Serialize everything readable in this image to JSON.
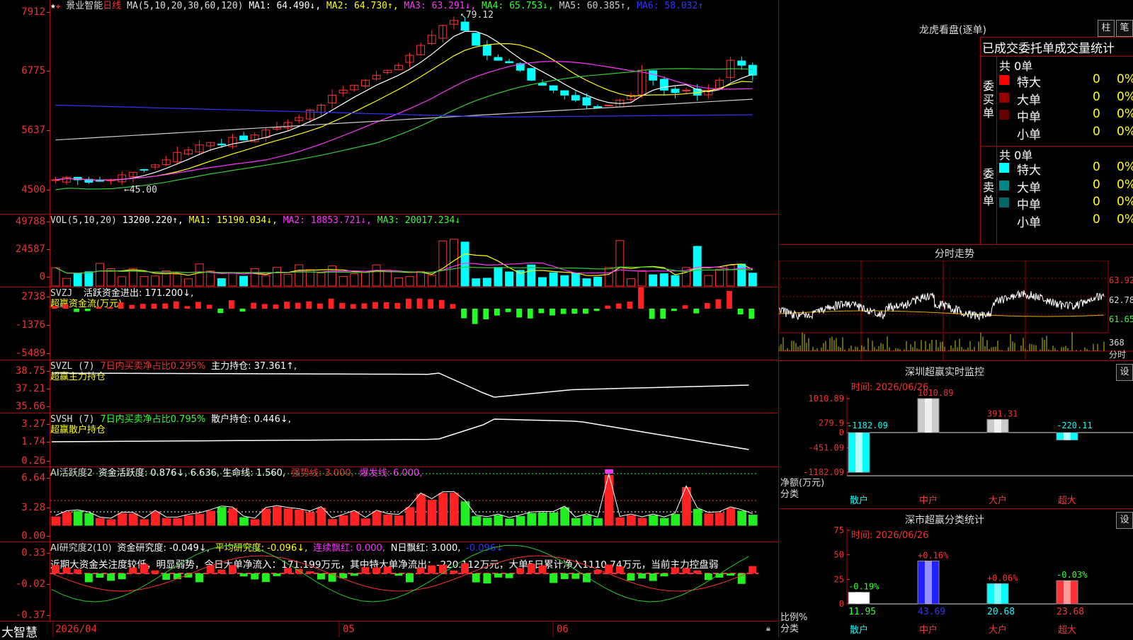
{
  "title_bar": {
    "app_name": "景业智能",
    "period": "日线"
  },
  "price_pane": {
    "ma_label": "MA(5,10,20,30,60,120)",
    "ma_values": [
      {
        "name": "MA1:",
        "value": "64.490↓,",
        "color": "#ffffff"
      },
      {
        "name": "MA2:",
        "value": "64.730↑,",
        "color": "#ffff00"
      },
      {
        "name": "MA3:",
        "value": "63.291↓,",
        "color": "#ff33ff"
      },
      {
        "name": "MA4:",
        "value": "65.753↓,",
        "color": "#33ff33"
      },
      {
        "name": "MA5:",
        "value": "60.385↑,",
        "color": "#cccccc"
      },
      {
        "name": "MA6:",
        "value": "58.032↑",
        "color": "#3333ff"
      }
    ],
    "y_ticks": [
      "7912",
      "6775",
      "5637",
      "4500"
    ],
    "high_marker": "79.12",
    "low_marker": "45.00"
  },
  "vol_pane": {
    "label": "VOL(5,10,20)",
    "value": "13200.220↑,",
    "ma1": "MA1: 15190.034↓,",
    "ma2": "MA2: 18853.721↓,",
    "ma3": "MA3: 20017.234↓",
    "y_ticks": [
      "49788",
      "24587",
      "0"
    ]
  },
  "svzj_pane": {
    "label": "SVZJ",
    "desc": "活跃资金进出: 171.200↓,",
    "sub": "超赢资金流(万元)",
    "y_ticks": [
      "2738",
      "-1376",
      "-5489"
    ]
  },
  "svzl_pane": {
    "label": "SVZL (7)",
    "desc": "7日内买卖净占比0.295%",
    "desc2": "主力持仓: 37.361↑,",
    "sub": "超赢主力持仓",
    "y_ticks": [
      "38.75",
      "37.21",
      "35.66"
    ]
  },
  "svsh_pane": {
    "label": "SVSH (7)",
    "desc": "7日内买卖净占比0.795%",
    "desc2": "散户持仓: 0.446↓,",
    "sub": "超赢散户持仓",
    "y_ticks": [
      "3.27",
      "1.74",
      "0.26"
    ]
  },
  "ai_active_pane": {
    "label": "AI活跃度2",
    "desc": "资金活跃度: 0.876↓, 6.636, 生命线: 1.560,",
    "strong": "强势线: 3.000,",
    "burst": "爆发线: 6.000,",
    "y_ticks": [
      "6.64",
      "3.28",
      "0.00"
    ]
  },
  "ai_research_pane": {
    "label": "AI研究度2(10)",
    "desc": "资金研究度: -0.049↓,",
    "avg": "平均研究度: -0.096↓,",
    "cont": "连续飘红: 0.000,",
    "nday": "N日飘红: 3.000,",
    "last": "-0.096↓",
    "comment": "近期大资金关注度较低，明显弱势，今日大单净流入：171.199万元，其中特大单净流出：-220.112万元，大单5日累计净入1110.74万元，当前主力控盘弱",
    "y_ticks": [
      "0.33",
      "-0.02",
      "-0.37"
    ]
  },
  "bottom_bar": {
    "brand": "大智慧",
    "date_start": "2026/04",
    "may": "05",
    "jun": "06"
  },
  "dragon_tiger": {
    "title": "龙虎看盘(逐单)",
    "btn_bar": "柱",
    "btn_stroke": "笔",
    "stats_header": "已成交委托单成交量统计",
    "buy_label": "委买单",
    "sell_label": "委卖单",
    "buy_total": "共 0单",
    "sell_total": "共 0单",
    "buy_rows": [
      {
        "label": "特大",
        "count": "0",
        "pct": "0%",
        "color": "#ff0000"
      },
      {
        "label": "大单",
        "count": "0",
        "pct": "0%",
        "color": "#990000"
      },
      {
        "label": "中单",
        "count": "0",
        "pct": "0%",
        "color": "#660000"
      },
      {
        "label": "小单",
        "count": "0",
        "pct": "0%",
        "color": ""
      }
    ],
    "sell_rows": [
      {
        "label": "特大",
        "count": "0",
        "pct": "0%",
        "color": "#00ffff"
      },
      {
        "label": "大单",
        "count": "0",
        "pct": "0%",
        "color": "#008888"
      },
      {
        "label": "中单",
        "count": "0",
        "pct": "0%",
        "color": "#006666"
      },
      {
        "label": "小单",
        "count": "0",
        "pct": "0%",
        "color": ""
      }
    ]
  },
  "intraday": {
    "title": "分时走势",
    "right_ticks": [
      "63.92",
      "62.78",
      "61.65"
    ],
    "vol_tick": "368",
    "vol_unit": "分时"
  },
  "sz_monitor": {
    "title": "深圳超赢实时监控",
    "setting_btn": "设",
    "date": "时间: 2026/06/26",
    "y_ticks": [
      "1010.89",
      "279.9",
      "0",
      "-451.09",
      "-1182.09"
    ],
    "y_title": "净额(万元)",
    "x_title": "分类",
    "categories": [
      "散户",
      "中户",
      "大户",
      "超大"
    ],
    "values": [
      "-1182.09",
      "1010.89",
      "391.31",
      "-220.11"
    ]
  },
  "sz_class": {
    "title": "深市超赢分类统计",
    "setting_btn": "设",
    "date": "时间: 2026/06/26",
    "y_ticks": [
      "75",
      "50",
      "25",
      "0"
    ],
    "y_title": "比例%",
    "x_title": "分类",
    "categories": [
      "散户",
      "中户",
      "大户",
      "超大"
    ],
    "changes": [
      "-0.19%",
      "+0.16%",
      "+0.06%",
      "-0.03%"
    ],
    "values": [
      "11.95",
      "43.69",
      "20.68",
      "23.68"
    ]
  }
}
